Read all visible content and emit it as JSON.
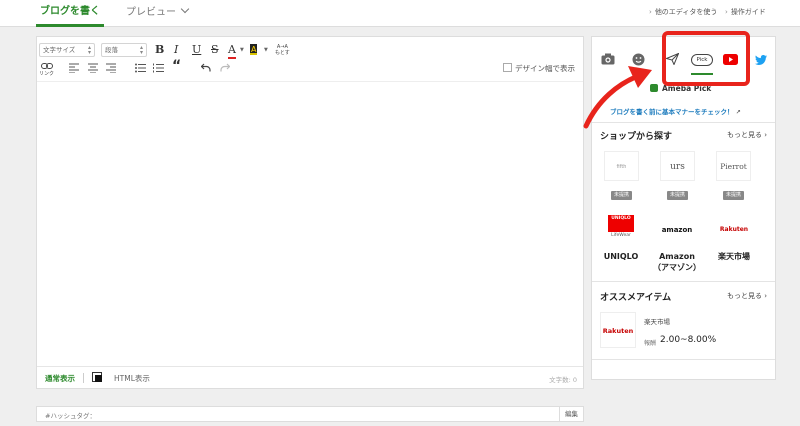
{
  "header": {
    "tabs": [
      {
        "label": "ブログを書く",
        "active": true
      },
      {
        "label": "プレビュー",
        "active": false
      }
    ],
    "links": [
      {
        "label": "他のエディタを使う"
      },
      {
        "label": "操作ガイド"
      }
    ]
  },
  "toolbar": {
    "font_size_select": "文字サイズ",
    "paragraph_select": "段落",
    "bold": "B",
    "italic": "I",
    "underline": "U",
    "strike": "S",
    "font_color": "A",
    "bg_color": "A",
    "design_width_label": "デザイン幅で表示",
    "link_label": "リンク",
    "reset_label": "もとす",
    "quote": "“"
  },
  "editor_footer": {
    "normal_mode": "通常表示",
    "html_mode": "HTML表示",
    "char_count": "文字数: 0"
  },
  "hashtag": {
    "label": "#ハッシュタグ：",
    "edit": "編集"
  },
  "sidebar": {
    "icons": [
      "camera-icon",
      "emoji-icon",
      "send-icon",
      "pick-icon",
      "youtube-icon",
      "twitter-icon"
    ],
    "pick_label": "Pick",
    "ameba_pick_title": "Ameba Pick",
    "manner_link": "ブログを書く前に基本マナーをチェック！",
    "shop_section": {
      "title": "ショップから探す",
      "more": "もっと見る",
      "shops": [
        {
          "logo": "fifth",
          "badge": "未提携"
        },
        {
          "logo": "urs",
          "badge": "未提携"
        },
        {
          "logo": "Pierrot",
          "badge": "未提携"
        }
      ],
      "stores": [
        {
          "logo": "UNIQLO",
          "logo_sub": "LifeWear",
          "name": "UNIQLO"
        },
        {
          "logo": "amazon",
          "name": "Amazon（アマゾン）"
        },
        {
          "logo": "Rakuten",
          "name": "楽天市場"
        }
      ]
    },
    "item_section": {
      "title": "オススメアイテム",
      "more": "もっと見る",
      "item": {
        "logo": "Rakuten",
        "shop": "楽天市場",
        "reward_label": "報酬",
        "reward": "2.00~8.00%"
      }
    }
  },
  "annotation": {
    "color": "#e8241c"
  },
  "colors": {
    "accent": "#2d8a2d",
    "link": "#1c7bbd"
  }
}
